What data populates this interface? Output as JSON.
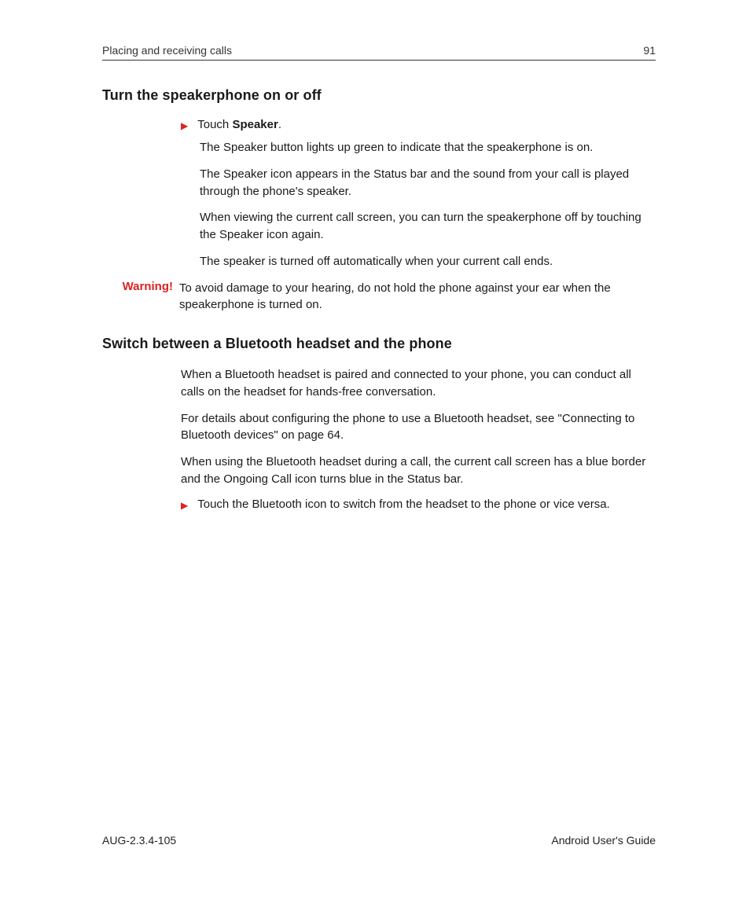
{
  "header": {
    "chapter": "Placing and receiving calls",
    "page_number": "91"
  },
  "section1": {
    "title": "Turn the speakerphone on or off",
    "action_prefix": "Touch ",
    "action_bold": "Speaker",
    "action_suffix": ".",
    "paragraphs": [
      "The Speaker button lights up green to indicate that the speakerphone is on.",
      "The Speaker icon appears in the Status bar and the sound from your call is played through the phone's speaker.",
      "When viewing the current call screen, you can turn the speakerphone off by touching the Speaker icon again.",
      "The speaker is turned off automatically when your current call ends."
    ],
    "warning_label": "Warning!",
    "warning_text": "To avoid damage to your hearing, do not hold the phone against your ear when the speakerphone is turned on."
  },
  "section2": {
    "title": "Switch between a Bluetooth headset and the phone",
    "paragraphs": [
      "When a Bluetooth headset is paired and connected to your phone, you can conduct all calls on the headset for hands-free conversation.",
      "For details about configuring the phone to use a Bluetooth headset, see \"Connecting to Bluetooth devices\" on page 64.",
      "When using the Bluetooth headset during a call, the current call screen has a blue border and the Ongoing Call icon turns blue in the Status bar."
    ],
    "bullet_text": "Touch the Bluetooth icon to switch from the headset to the phone or vice versa."
  },
  "footer": {
    "doc_id": "AUG-2.3.4-105",
    "doc_title": "Android User's Guide"
  }
}
